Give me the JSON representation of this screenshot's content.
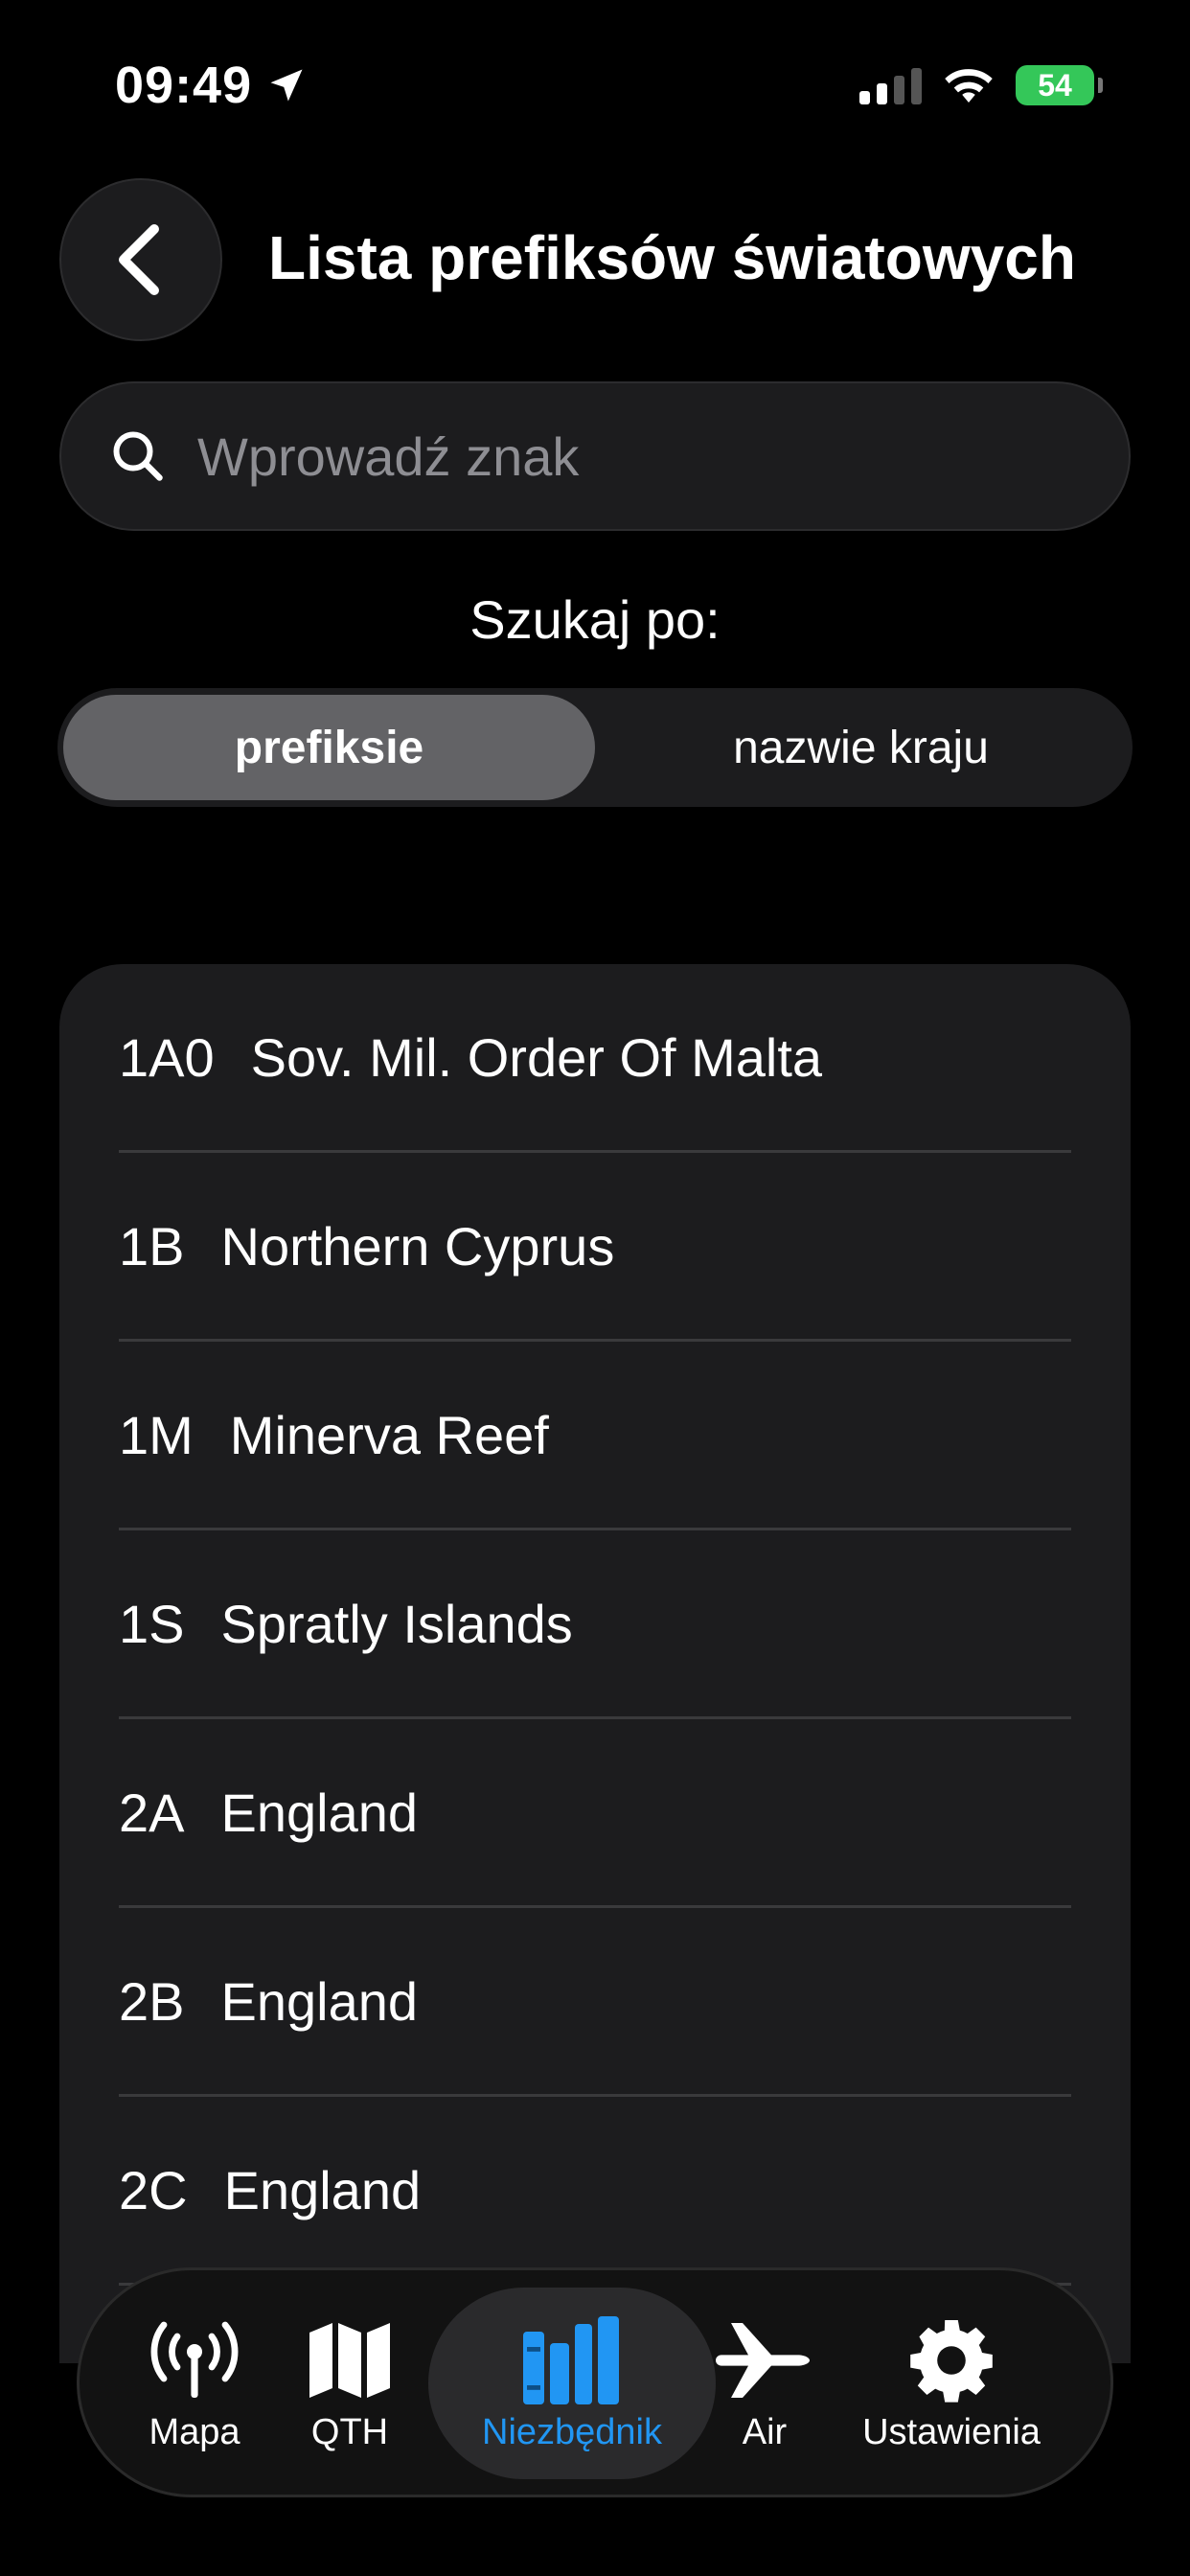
{
  "status_bar": {
    "time": "09:49",
    "battery": "54"
  },
  "header": {
    "title": "Lista prefiksów światowych"
  },
  "search": {
    "placeholder": "Wprowadź znak",
    "value": ""
  },
  "search_by": {
    "label": "Szukaj po:",
    "options": [
      "prefiksie",
      "nazwie kraju"
    ],
    "selected": "prefiksie"
  },
  "list": [
    {
      "prefix": "1A0",
      "country": "Sov. Mil. Order Of Malta"
    },
    {
      "prefix": "1B",
      "country": "Northern Cyprus"
    },
    {
      "prefix": "1M",
      "country": "Minerva Reef"
    },
    {
      "prefix": "1S",
      "country": "Spratly Islands"
    },
    {
      "prefix": "2A",
      "country": "England"
    },
    {
      "prefix": "2B",
      "country": "England"
    },
    {
      "prefix": "2C",
      "country": "England"
    }
  ],
  "tabbar": {
    "items": [
      {
        "label": "Mapa",
        "icon": "antenna-icon"
      },
      {
        "label": "QTH",
        "icon": "map-icon"
      },
      {
        "label": "Niezbędnik",
        "icon": "books-icon"
      },
      {
        "label": "Air",
        "icon": "airplane-icon"
      },
      {
        "label": "Ustawienia",
        "icon": "gear-icon"
      }
    ],
    "active": "Niezbędnik"
  },
  "colors": {
    "accent": "#2196f3",
    "battery": "#34c759",
    "card": "#1c1c1e"
  }
}
